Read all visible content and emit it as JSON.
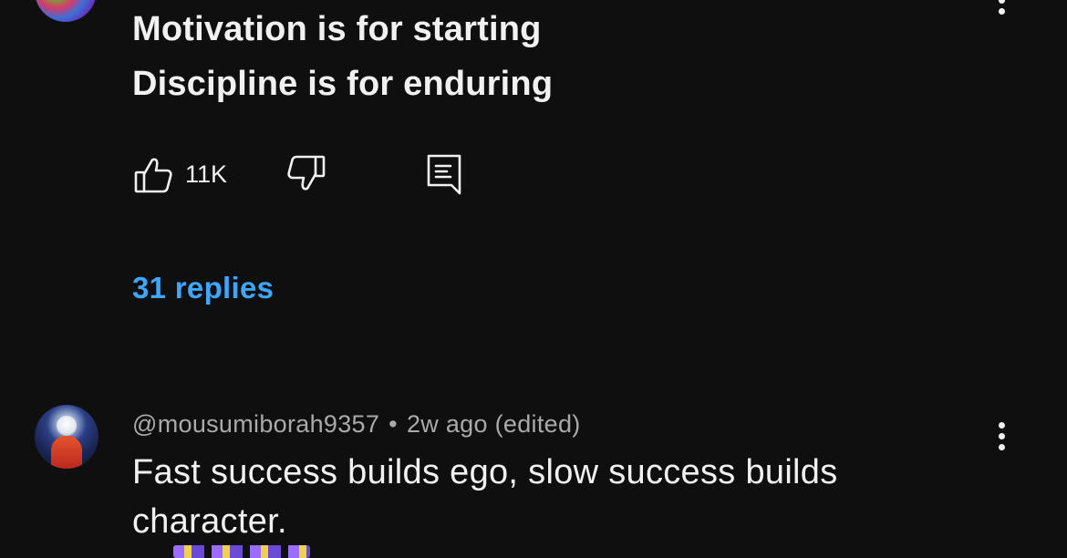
{
  "comment1": {
    "line1": "Motivation is for starting",
    "line2": "Discipline is for enduring",
    "likes": "11K",
    "replies_label": "31 replies"
  },
  "comment2": {
    "handle": "@mousumiborah9357",
    "separator": "•",
    "time": "2w ago (edited)",
    "line1": "Fast success builds ego, slow success builds",
    "line2": "character."
  },
  "icons": {
    "like": "thumbs-up-icon",
    "dislike": "thumbs-down-icon",
    "reply": "reply-comment-icon",
    "more": "more-vertical-icon"
  },
  "colors": {
    "background": "#0f0f0f",
    "text": "#f1f1f1",
    "secondary_text": "#aaaaaa",
    "link": "#3ea6ff"
  }
}
